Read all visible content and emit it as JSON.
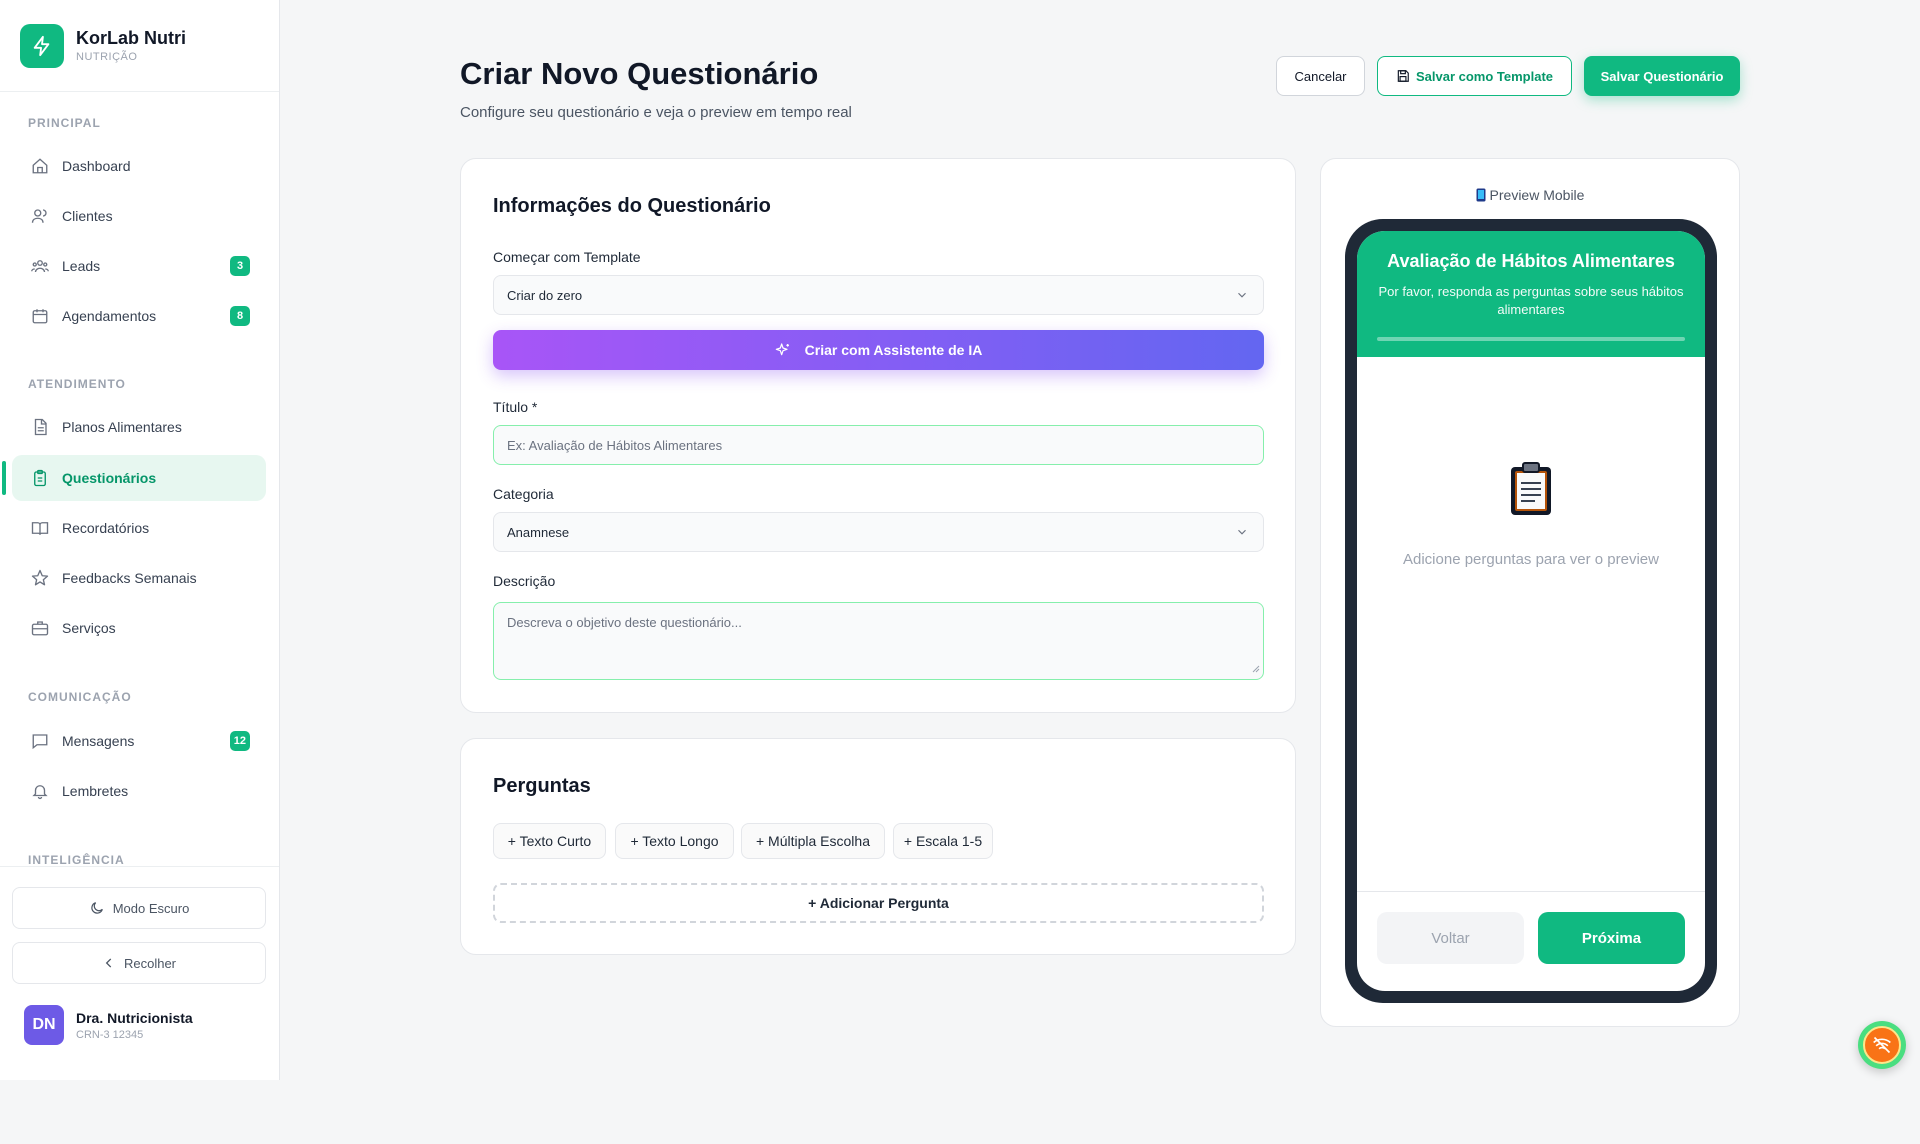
{
  "brand": {
    "name": "KorLab Nutri",
    "sub": "NUTRIÇÃO"
  },
  "sidebar": {
    "sections": [
      {
        "label": "PRINCIPAL"
      },
      {
        "label": "ATENDIMENTO"
      },
      {
        "label": "COMUNICAÇÃO"
      },
      {
        "label": "INTELIGÊNCIA"
      }
    ],
    "items": [
      {
        "label": "Dashboard",
        "icon": "home-icon"
      },
      {
        "label": "Clientes",
        "icon": "users-icon"
      },
      {
        "label": "Leads",
        "icon": "group-icon",
        "badge": "3"
      },
      {
        "label": "Agendamentos",
        "icon": "calendar-icon",
        "badge": "8"
      },
      {
        "label": "Planos Alimentares",
        "icon": "document-icon"
      },
      {
        "label": "Questionários",
        "icon": "clipboard-icon",
        "active": true
      },
      {
        "label": "Recordatórios",
        "icon": "book-icon"
      },
      {
        "label": "Feedbacks Semanais",
        "icon": "star-icon"
      },
      {
        "label": "Serviços",
        "icon": "briefcase-icon"
      },
      {
        "label": "Mensagens",
        "icon": "message-icon",
        "badge": "12"
      },
      {
        "label": "Lembretes",
        "icon": "bell-icon"
      }
    ],
    "dark_mode": "Modo Escuro",
    "collapse": "Recolher",
    "user": {
      "initials": "DN",
      "name": "Dra. Nutricionista",
      "crn": "CRN-3 12345"
    }
  },
  "header": {
    "title": "Criar Novo Questionário",
    "subtitle": "Configure seu questionário e veja o preview em tempo real",
    "cancel": "Cancelar",
    "save_template": "Salvar como Template",
    "save": "Salvar Questionário"
  },
  "info": {
    "title": "Informações do Questionário",
    "template_label": "Começar com Template",
    "template_value": "Criar do zero",
    "ai_button": "Criar com Assistente de IA",
    "title_label": "Título *",
    "title_placeholder": "Ex: Avaliação de Hábitos Alimentares",
    "category_label": "Categoria",
    "category_value": "Anamnese",
    "description_label": "Descrição",
    "description_placeholder": "Descreva o objetivo deste questionário..."
  },
  "questions": {
    "title": "Perguntas",
    "types": [
      "+ Texto Curto",
      "+ Texto Longo",
      "+ Múltipla Escolha",
      "+ Escala 1-5"
    ],
    "add": "+ Adicionar Pergunta"
  },
  "preview": {
    "label": "Preview Mobile",
    "form_title": "Avaliação de Hábitos Alimentares",
    "form_subtitle": "Por favor, responda as perguntas sobre seus hábitos alimentares",
    "progress": 0,
    "empty": "Adicione perguntas para ver o preview",
    "back": "Voltar",
    "next": "Próxima"
  },
  "colors": {
    "accent": "#10b981",
    "ai_start": "#a855f7",
    "ai_end": "#6366f1",
    "phone": "#1f2937"
  }
}
